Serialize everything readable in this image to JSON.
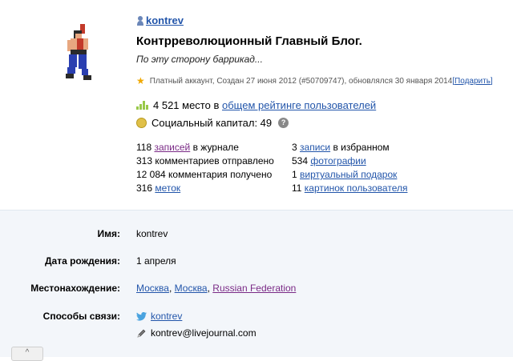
{
  "profile": {
    "username": "kontrev",
    "blog_title": "Контрреволюционный Главный Блог.",
    "blog_subtitle": "По эту сторону баррикад...",
    "account_info": "Платный аккаунт, Создан 27 июня 2012 (#50709747),  обновлялся 30 января 2014",
    "gift_link": "[Подарить]"
  },
  "rating": {
    "prefix": "4 521 место в",
    "link": "общем рейтинге пользователей"
  },
  "social_capital": {
    "text": "Социальный капитал: 49",
    "help": "?"
  },
  "stats_left": [
    {
      "pre": "118 ",
      "link": "записей",
      "post": " в журнале"
    },
    {
      "pre": "313 комментариев отправлено",
      "link": "",
      "post": ""
    },
    {
      "pre": "12 084 комментария получено",
      "link": "",
      "post": ""
    },
    {
      "pre": "316 ",
      "link": "меток",
      "post": ""
    }
  ],
  "stats_right": [
    {
      "pre": "3 ",
      "link": "записи",
      "post": " в избранном"
    },
    {
      "pre": "534 ",
      "link": "фотографии",
      "post": ""
    },
    {
      "pre": "1 ",
      "link": "виртуальный подарок",
      "post": ""
    },
    {
      "pre": "11 ",
      "link": "картинок пользователя",
      "post": ""
    }
  ],
  "details": {
    "name_label": "Имя:",
    "name_value": "kontrev",
    "birthday_label": "Дата рождения:",
    "birthday_value": "1 апреля",
    "location_label": "Местонахождение:",
    "location_city": "Москва",
    "location_region": "Москва",
    "location_country": "Russian Federation",
    "contacts_label": "Способы связи:",
    "twitter": "kontrev",
    "email": "kontrev@livejournal.com"
  },
  "colors": {
    "link": "#2255aa",
    "visited": "#7a2a86",
    "panel_bg": "#f3f6fa",
    "star": "#f0a800",
    "rating_bars": "#99c94a"
  },
  "icons": {
    "user": "user-icon",
    "star": "star-icon",
    "rating": "rating-bars-icon",
    "capital": "coin-icon",
    "help": "help-icon",
    "twitter": "twitter-icon",
    "email": "pencil-icon",
    "scroll": "chevron-up-icon"
  },
  "scroll_top_glyph": "^"
}
